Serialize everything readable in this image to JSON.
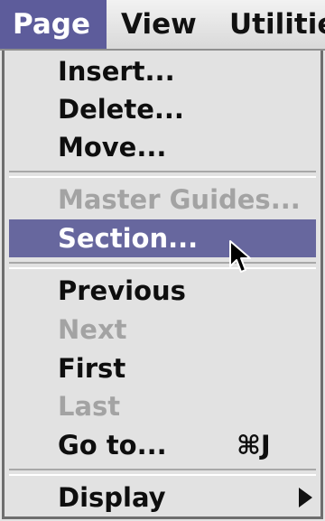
{
  "menubar": {
    "items": [
      {
        "label": "Page",
        "active": true
      },
      {
        "label": "View",
        "active": false
      },
      {
        "label": "Utilitie",
        "active": false
      }
    ]
  },
  "menu": {
    "items": [
      {
        "label": "Insert...",
        "enabled": true
      },
      {
        "label": "Delete...",
        "enabled": true
      },
      {
        "label": "Move...",
        "enabled": true
      },
      {
        "label": "Master Guides...",
        "enabled": false
      },
      {
        "label": "Section...",
        "enabled": true,
        "selected": true
      },
      {
        "label": "Previous",
        "enabled": true
      },
      {
        "label": "Next",
        "enabled": false
      },
      {
        "label": "First",
        "enabled": true
      },
      {
        "label": "Last",
        "enabled": false
      },
      {
        "label": "Go to...",
        "enabled": true,
        "shortcut": "⌘J"
      },
      {
        "label": "Display",
        "enabled": true,
        "submenu": true
      }
    ]
  },
  "colors": {
    "highlight": "#67679e",
    "menu_bg": "#e2e2e2",
    "disabled_text": "#a3a3a3"
  },
  "icons": {
    "cursor": "arrow-pointer-icon",
    "submenu": "submenu-arrow-icon"
  }
}
